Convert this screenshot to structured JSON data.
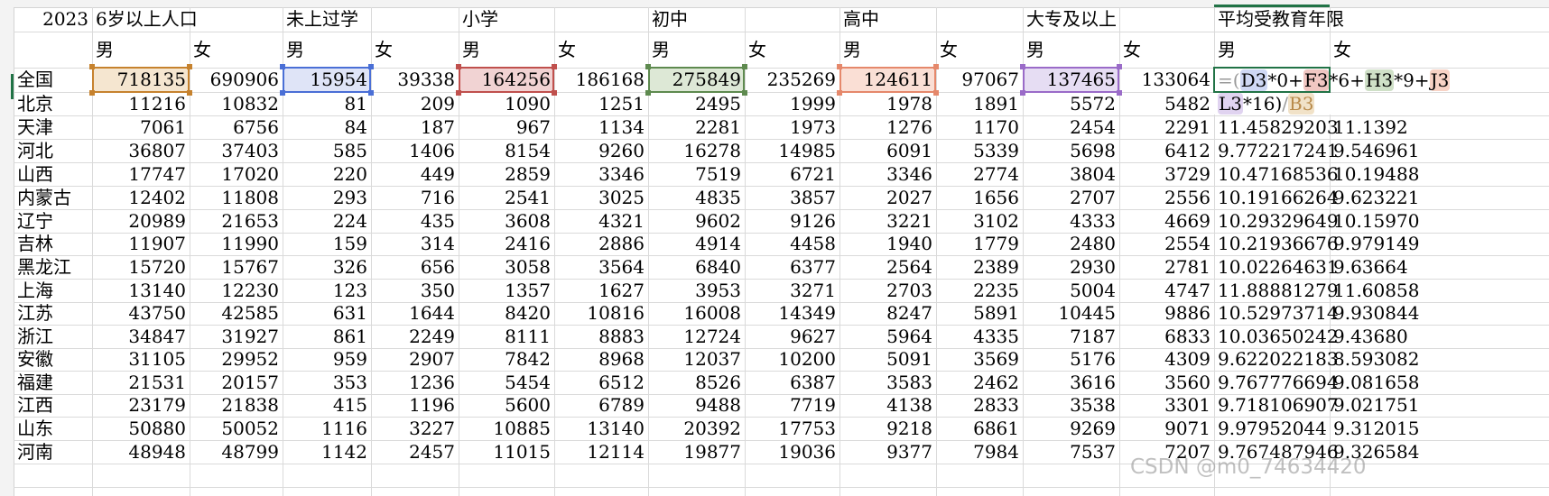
{
  "header": {
    "year": "2023",
    "groups": [
      "6岁以上人口",
      "未上过学",
      "小学",
      "初中",
      "高中",
      "大专及以上",
      "平均受教育年限"
    ],
    "male": "男",
    "female": "女"
  },
  "rows": [
    {
      "region": "全国",
      "values": [
        "718135",
        "690906",
        "15954",
        "39338",
        "164256",
        "186168",
        "275849",
        "235269",
        "124611",
        "97067",
        "137465",
        "133064"
      ],
      "avg_m": "",
      "avg_f": ""
    },
    {
      "region": "北京",
      "values": [
        "11216",
        "10832",
        "81",
        "209",
        "1090",
        "1251",
        "2495",
        "1999",
        "1978",
        "1891",
        "5572",
        "5482"
      ],
      "avg_m": "",
      "avg_f": ""
    },
    {
      "region": "天津",
      "values": [
        "7061",
        "6756",
        "84",
        "187",
        "967",
        "1134",
        "2281",
        "1973",
        "1276",
        "1170",
        "2454",
        "2291"
      ],
      "avg_m": "11.45829203",
      "avg_f": "11.1392"
    },
    {
      "region": "河北",
      "values": [
        "36807",
        "37403",
        "585",
        "1406",
        "8154",
        "9260",
        "16278",
        "14985",
        "6091",
        "5339",
        "5698",
        "6412"
      ],
      "avg_m": "9.772217241",
      "avg_f": "9.546961"
    },
    {
      "region": "山西",
      "values": [
        "17747",
        "17020",
        "220",
        "449",
        "2859",
        "3346",
        "7519",
        "6721",
        "3346",
        "2774",
        "3804",
        "3729"
      ],
      "avg_m": "10.47168536",
      "avg_f": "10.19488"
    },
    {
      "region": "内蒙古",
      "values": [
        "12402",
        "11808",
        "293",
        "716",
        "2541",
        "3025",
        "4835",
        "3857",
        "2027",
        "1656",
        "2707",
        "2556"
      ],
      "avg_m": "10.19166264",
      "avg_f": "9.623221"
    },
    {
      "region": "辽宁",
      "values": [
        "20989",
        "21653",
        "224",
        "435",
        "3608",
        "4321",
        "9602",
        "9126",
        "3221",
        "3102",
        "4333",
        "4669"
      ],
      "avg_m": "10.29329649",
      "avg_f": "10.15970"
    },
    {
      "region": "吉林",
      "values": [
        "11907",
        "11990",
        "159",
        "314",
        "2416",
        "2886",
        "4914",
        "4458",
        "1940",
        "1779",
        "2480",
        "2554"
      ],
      "avg_m": "10.21936676",
      "avg_f": "9.979149"
    },
    {
      "region": "黑龙江",
      "values": [
        "15720",
        "15767",
        "326",
        "656",
        "3058",
        "3564",
        "6840",
        "6377",
        "2564",
        "2389",
        "2930",
        "2781"
      ],
      "avg_m": "10.02264631",
      "avg_f": "9.63664"
    },
    {
      "region": "上海",
      "values": [
        "13140",
        "12230",
        "123",
        "350",
        "1357",
        "1627",
        "3953",
        "3271",
        "2703",
        "2235",
        "5004",
        "4747"
      ],
      "avg_m": "11.88881279",
      "avg_f": "11.60858"
    },
    {
      "region": "江苏",
      "values": [
        "43750",
        "42585",
        "631",
        "1644",
        "8420",
        "10816",
        "16008",
        "14349",
        "8247",
        "5891",
        "10445",
        "9886"
      ],
      "avg_m": "10.52973714",
      "avg_f": "9.930844"
    },
    {
      "region": "浙江",
      "values": [
        "34847",
        "31927",
        "861",
        "2249",
        "8111",
        "8883",
        "12724",
        "9627",
        "5964",
        "4335",
        "7187",
        "6833"
      ],
      "avg_m": "10.03650242",
      "avg_f": "9.43680"
    },
    {
      "region": "安徽",
      "values": [
        "31105",
        "29952",
        "959",
        "2907",
        "7842",
        "8968",
        "12037",
        "10200",
        "5091",
        "3569",
        "5176",
        "4309"
      ],
      "avg_m": "9.622022183",
      "avg_f": "8.593082"
    },
    {
      "region": "福建",
      "values": [
        "21531",
        "20157",
        "353",
        "1236",
        "5454",
        "6512",
        "8526",
        "6387",
        "3583",
        "2462",
        "3616",
        "3560"
      ],
      "avg_m": "9.767776694",
      "avg_f": "9.081658"
    },
    {
      "region": "江西",
      "values": [
        "23179",
        "21838",
        "415",
        "1196",
        "5600",
        "6789",
        "9488",
        "7719",
        "4138",
        "2833",
        "3538",
        "3301"
      ],
      "avg_m": "9.718106907",
      "avg_f": "9.021751"
    },
    {
      "region": "山东",
      "values": [
        "50880",
        "50052",
        "1116",
        "3227",
        "10885",
        "13140",
        "20392",
        "17753",
        "9218",
        "6861",
        "9269",
        "9071"
      ],
      "avg_m": "9.97952044",
      "avg_f": "9.312015"
    },
    {
      "region": "河南",
      "values": [
        "48948",
        "48799",
        "1142",
        "2457",
        "11015",
        "12114",
        "19877",
        "19036",
        "9377",
        "7984",
        "7537",
        "7207"
      ],
      "avg_m": "9.767487946",
      "avg_f": "9.326584"
    }
  ],
  "formula": {
    "line1": [
      "=(",
      "D3",
      "*0+",
      "F3",
      "*6+",
      "H3",
      "*9+",
      "J3"
    ],
    "line2": [
      "L3",
      "*16)",
      "/",
      "B3"
    ]
  },
  "colors": {
    "grid": "#dadada",
    "excel_green": "#217346",
    "ref_orange": "#c6822e",
    "ref_blue": "#4a6fd6",
    "ref_red": "#c0504d",
    "ref_green": "#5e8a4f",
    "ref_salmon": "#e5886b",
    "ref_purple": "#9a6bc8"
  },
  "watermark": "CSDN @m0_74634420"
}
